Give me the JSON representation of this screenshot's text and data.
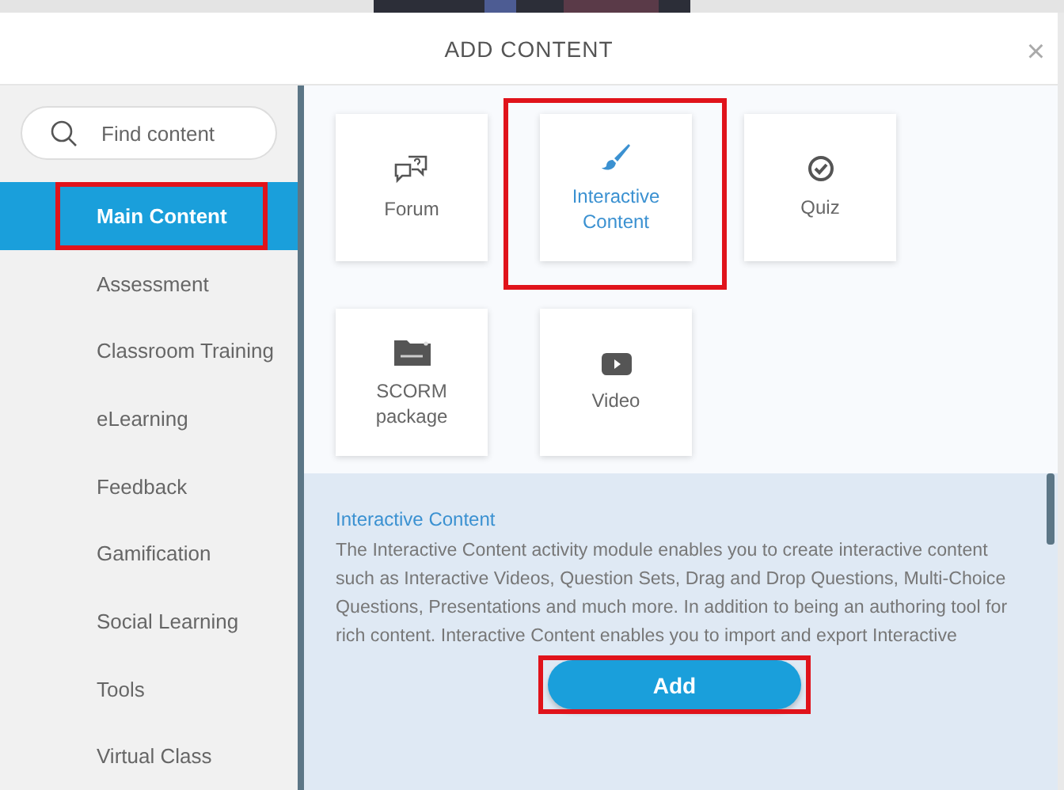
{
  "dialog": {
    "title": "ADD CONTENT",
    "close": "×"
  },
  "search": {
    "placeholder": "Find content"
  },
  "categories": [
    {
      "label": "Main Content",
      "selected": true,
      "highlighted": true
    },
    {
      "label": "Assessment",
      "selected": false,
      "highlighted": false
    },
    {
      "label": "Classroom Training",
      "selected": false,
      "highlighted": false
    },
    {
      "label": "eLearning",
      "selected": false,
      "highlighted": false
    },
    {
      "label": "Feedback",
      "selected": false,
      "highlighted": false
    },
    {
      "label": "Gamification",
      "selected": false,
      "highlighted": false
    },
    {
      "label": "Social Learning",
      "selected": false,
      "highlighted": false
    },
    {
      "label": "Tools",
      "selected": false,
      "highlighted": false
    },
    {
      "label": "Virtual Class",
      "selected": false,
      "highlighted": false
    }
  ],
  "tiles": [
    {
      "kind": "forum",
      "label": "Forum",
      "selected": false,
      "highlighted": false
    },
    {
      "kind": "brush",
      "label": "Interactive Content",
      "selected": true,
      "highlighted": true
    },
    {
      "kind": "quiz",
      "label": "Quiz",
      "selected": false,
      "highlighted": false
    },
    {
      "kind": "scorm",
      "label": "SCORM package",
      "selected": false,
      "highlighted": false
    },
    {
      "kind": "video",
      "label": "Video",
      "selected": false,
      "highlighted": false
    }
  ],
  "description": {
    "title": "Interactive Content",
    "text": "The Interactive Content activity module enables you to create interactive content such as Interactive Videos, Question Sets, Drag and Drop Questions, Multi-Choice Questions, Presentations and much more. In addition to being an authoring tool for rich content. Interactive Content enables you to import and export Interactive"
  },
  "add_button": {
    "label": "Add",
    "highlighted": true
  }
}
